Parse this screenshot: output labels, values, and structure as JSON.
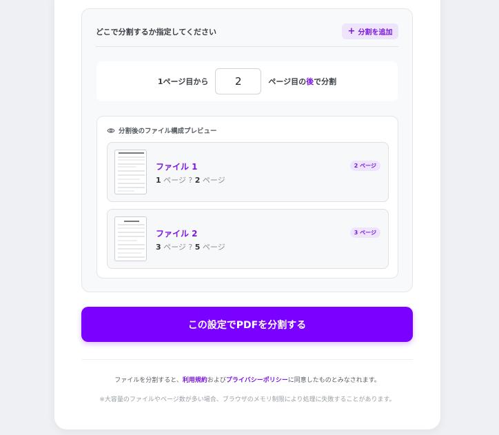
{
  "panel": {
    "title": "どこで分割するか指定してください",
    "add_label": "分割を追加"
  },
  "range": {
    "prefix": "1ページ目から",
    "value": "2",
    "suffix_before": "ページ目の",
    "suffix_accent": "後",
    "suffix_after": "で分割"
  },
  "preview": {
    "title": "分割後のファイル構成プレビュー",
    "files": [
      {
        "name": "ファイル 1",
        "start": "1",
        "sep1": " ページ ? ",
        "end": "2",
        "sep2": " ページ",
        "badge": "2 ページ"
      },
      {
        "name": "ファイル 2",
        "start": "3",
        "sep1": " ページ ? ",
        "end": "5",
        "sep2": " ページ",
        "badge": "3 ページ"
      }
    ]
  },
  "submit_label": "この設定でPDFを分割する",
  "terms": {
    "before": "ファイルを分割すると、",
    "terms_link": "利用規約",
    "middle": "および",
    "privacy_link": "プライバシーポリシー",
    "after": "に同意したものとみなされます。"
  },
  "note": "※大容量のファイルやページ数が多い場合、ブラウザのメモリ制限により処理に失敗することがあります。",
  "colors": {
    "accent": "#7a00ff",
    "badge_bg": "#eee4fb"
  }
}
